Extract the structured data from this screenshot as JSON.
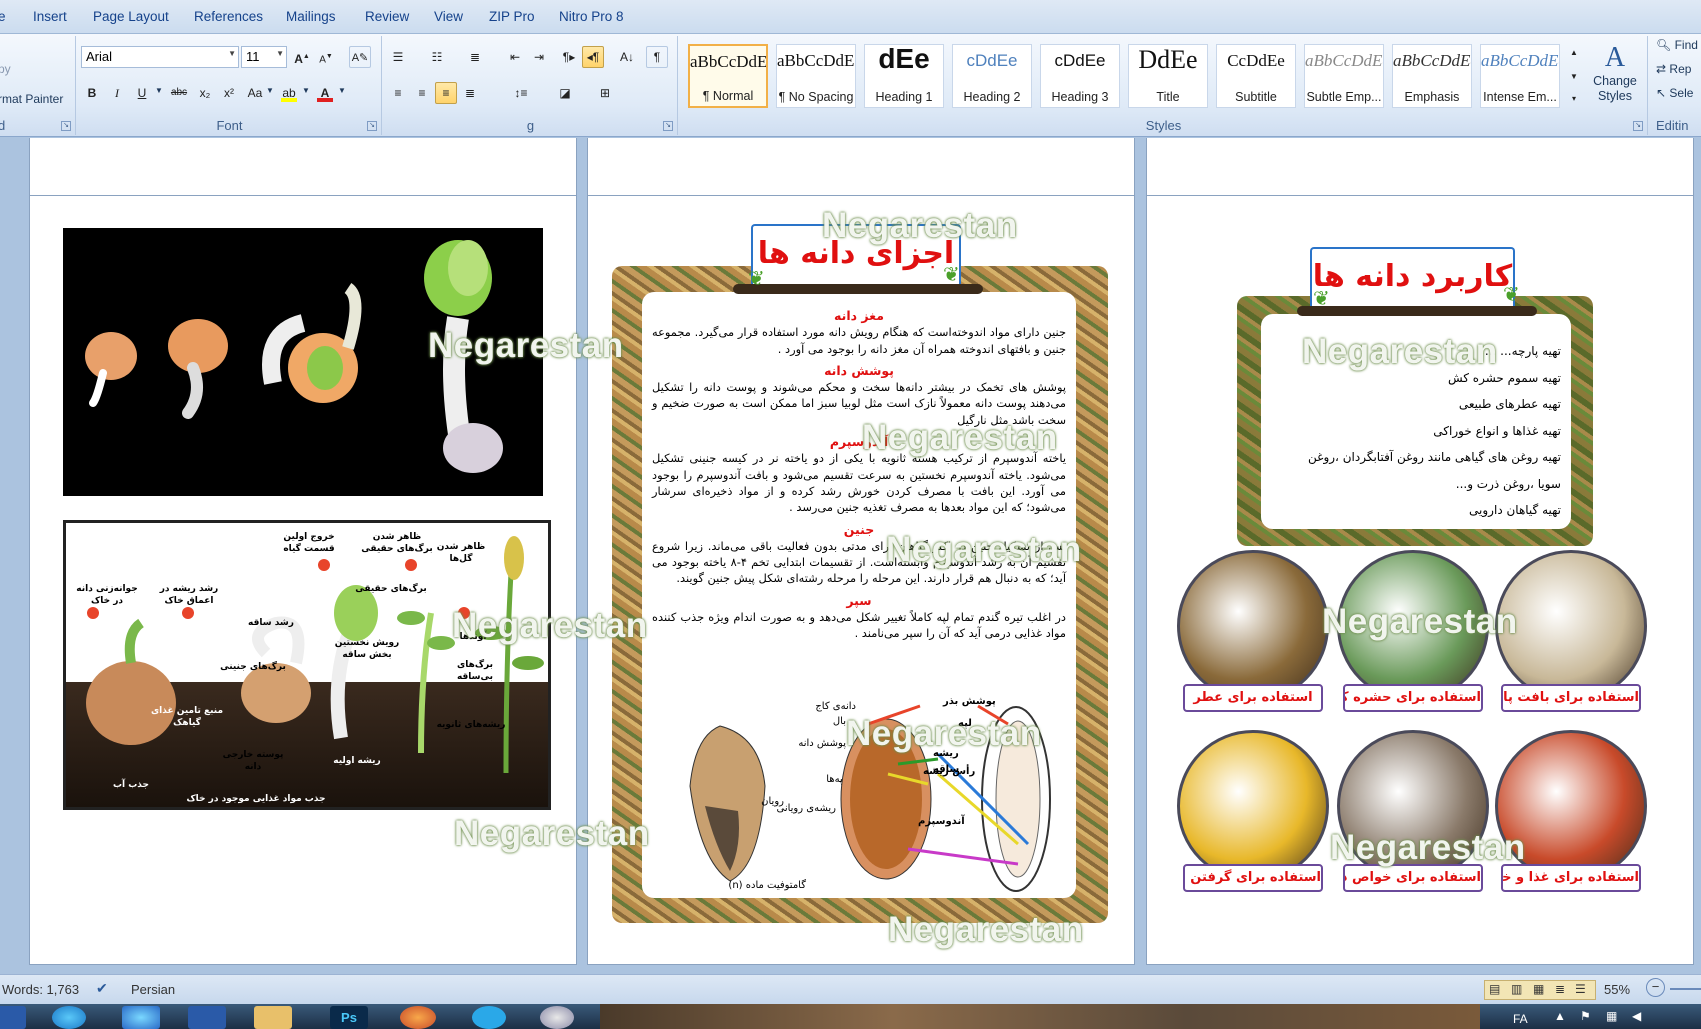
{
  "tabs": [
    "e",
    "Insert",
    "Page Layout",
    "References",
    "Mailings",
    "Review",
    "View",
    "ZIP Pro",
    "Nitro Pro 8"
  ],
  "clipboard": {
    "copy_label": "py",
    "format_painter_label": "rmat Painter",
    "group_label": "d"
  },
  "font": {
    "name": "Arial",
    "size": "11",
    "group_label": "Font",
    "bold": "B",
    "italic": "I",
    "underline": "U",
    "strike": "abc",
    "subscript": "x₂",
    "superscript": "x²",
    "change_case": "Aa",
    "grow": "A",
    "shrink": "A",
    "highlight_color": "#ffff00",
    "font_color_accent": "#e02020"
  },
  "paragraph": {
    "group_label": "g"
  },
  "styles": {
    "group_label": "Styles",
    "items": [
      {
        "sample": "aBbCcDdEe",
        "name": "¶ Normal"
      },
      {
        "sample": "aBbCcDdEe",
        "name": "¶ No Spacing"
      },
      {
        "sample": "dEe",
        "name": "Heading 1"
      },
      {
        "sample": "cDdEe",
        "name": "Heading 2"
      },
      {
        "sample": "cDdEe",
        "name": "Heading 3"
      },
      {
        "sample": "DdEe",
        "name": "Title"
      },
      {
        "sample": "CcDdEe",
        "name": "Subtitle"
      },
      {
        "sample": "aBbCcDdEe",
        "name": "Subtle Emp..."
      },
      {
        "sample": "aBbCcDdEe",
        "name": "Emphasis"
      },
      {
        "sample": "aBbCcDdEe",
        "name": "Intense Em..."
      }
    ],
    "change_styles": "Change Styles"
  },
  "editing": {
    "find": "Find",
    "replace": "Rep",
    "select": "Sele",
    "group_label": "Editin"
  },
  "watermark": "Negarestan",
  "page2": {
    "title": "اجزای دانه ها",
    "sections": [
      {
        "heading": "مغز دانه",
        "body": "جنین دارای مواد اندوخته‌است که هنگام رویش دانه مورد استفاده قرار می‌گیرد. مجموعه جنین و بافتهای اندوخته همراه آن مغز دانه را بوجود می آورد ."
      },
      {
        "heading": "پوشش دانه",
        "body": "پوشش های تخمک در بیشتر دانه‌ها سخت و محکم می‌شوند و پوست دانه را تشکیل می‌دهند پوست دانه معمولاً نازک است مثل لوبیا سبز اما ممکن است به صورت ضخیم و سخت باشد مثل نارگیل"
      },
      {
        "heading": "آندوسپرم",
        "body": "یاخته آندوسپرم از ترکیب هسته ثانویه با یکی از دو یاخته نر در کیسه جنینی تشکیل می‌شود. یاخته آندوسپرم نخستین به سرعت تقسیم می‌شود و بافت آندوسپرم را بوجود می آورد. این بافت با مصرف کردن خورش رشد کرده و از مواد ذخیره‌ای سرشار می‌شود؛ که این مواد بعدها به مصرف تغذیه جنین می‌رسد ."
      },
      {
        "heading": "جنین",
        "body": "پس از تشکیل جنین در اکثر گیاهان برای مدتی بدون فعالیت باقی می‌ماند. زیرا شروع تقسیم آن به رشد آندوسپرم وابسته‌است. از تقسیمات ابتدایی تخم ۴-۸ یاخته بوجود می آید؛ که به دنبال هم قرار دارند. این مرحله را مرحله رشته‌ای شکل پیش جنین گویند."
      },
      {
        "heading": "سپر",
        "body": "در اغلب تیره گندم تمام لپه کاملاً تغییر شکل می‌دهد و به صورت اندام ویژه جذب کننده مواد غذایی درمی آید که آن را سپر می‌نامند ."
      }
    ],
    "diagram_left": {
      "labels": [
        "دانه‌ی کاج",
        "بال",
        "پوشش دانه",
        "لپه‌ها",
        "رویان",
        "ریشه‌ی رویانی",
        "گامتوفیت ماده (n)"
      ]
    },
    "diagram_right": {
      "labels": [
        "پوشش بذر",
        "لپه",
        "ساقه",
        "ریشه",
        "رأس ریشه",
        "آندوسپرم"
      ]
    }
  },
  "page1": {
    "diagram_labels": [
      "جوانه‌زنی دانه در خاک",
      "رشد ریشه در اعماق خاک",
      "خروج اولین قسمت گیاه",
      "ظاهر شدن برگ‌های حقیقی",
      "ظاهر شدن گل‌ها",
      "رشد ساقه",
      "برگ‌های حقیقی",
      "رویش نخستین بخش ساقه",
      "برگ‌های جنینی",
      "آوندها",
      "برگ‌های بی‌ساقه",
      "ریشه‌های ثانویه",
      "پوسته خارجی دانه",
      "منبع تامین غذای گیاهک",
      "ریشه اولیه",
      "جذب آب",
      "جذب مواد غذایی موجود در خاک"
    ]
  },
  "page3": {
    "title": "کاربرد دانه ها",
    "items": [
      "تهیه پارچه‌... ...",
      "تهیه سموم حشره کش",
      "تهیه عطرهای طبیعی",
      "تهیه غذاها و انواع خوراکی",
      "تهیه روغن های گیاهی مانند روغن آفتابگردان ،روغن",
      "سویا ،روغن ذرت و...",
      "تهیه گیاهان دارویی"
    ],
    "captions": [
      "استفاده برای بافت پارچه",
      "استفاده برای حشره کش",
      "استفاده برای عطر",
      "استفاده برای غذا و خوراکی",
      "استفاده برای خواص دارویی",
      "استفاده برای گرفتن روغن"
    ]
  },
  "status": {
    "words": "Words: 1,763",
    "language": "Persian",
    "zoom": "55%"
  },
  "taskbar": {
    "lang": "FA"
  }
}
